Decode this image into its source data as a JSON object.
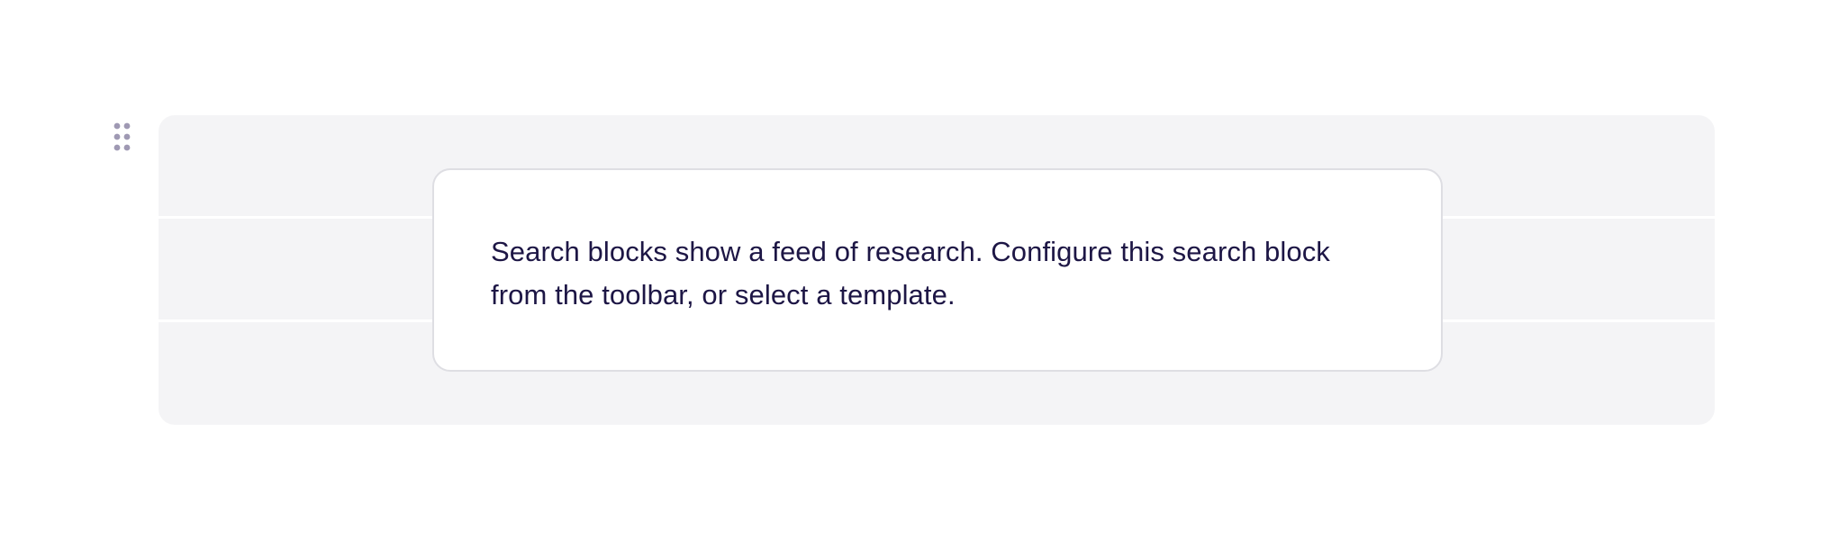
{
  "editor": {
    "block": {
      "drag_handle_icon": "drag-handle-dots-icon",
      "placeholder_rows": 3,
      "notice": {
        "text": "Search blocks show a feed of research. Configure this search block from the toolbar, or select a template."
      }
    }
  },
  "colors": {
    "block_background": "#f4f4f6",
    "card_background": "#ffffff",
    "card_border": "#dedee3",
    "text": "#1d1645",
    "handle_dots": "#9f99b3"
  }
}
